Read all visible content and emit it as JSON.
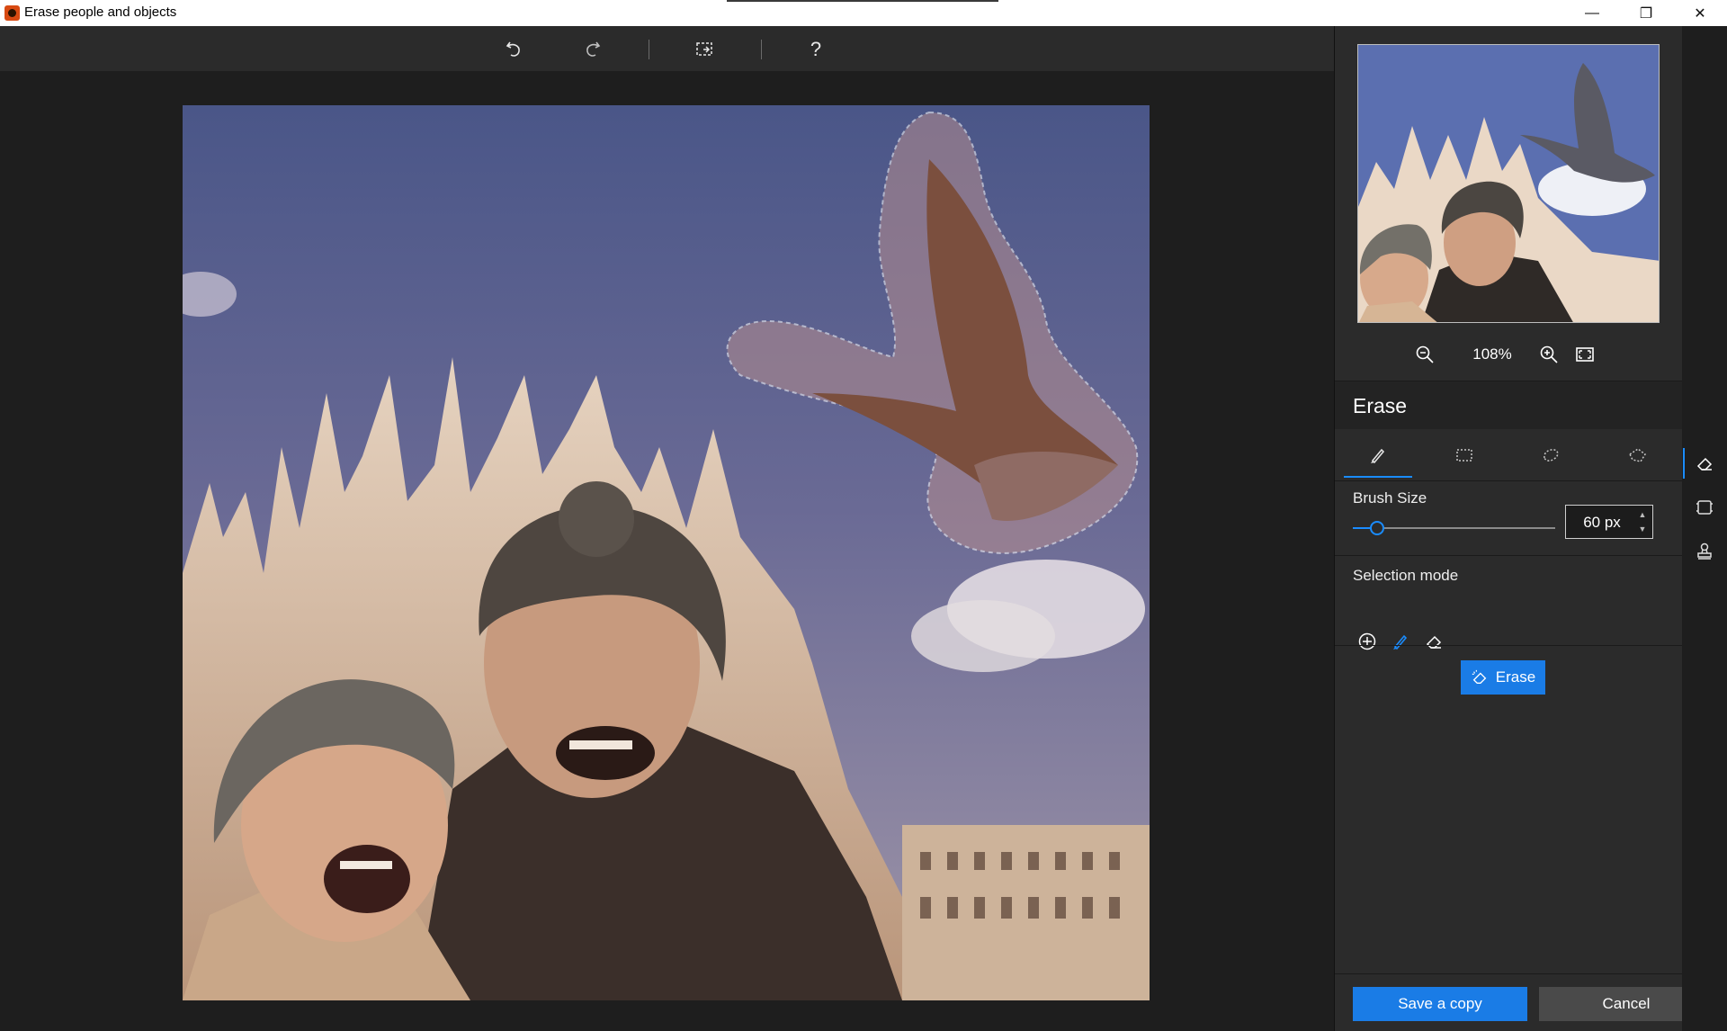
{
  "window": {
    "title": "Erase people and objects",
    "minimize_glyph": "—",
    "maximize_glyph": "❐",
    "close_glyph": "✕"
  },
  "toolbar": {
    "undo_icon": "undo-icon",
    "redo_icon": "redo-icon",
    "compare_icon": "compare-icon",
    "help_label": "?"
  },
  "preview": {
    "zoom_level": "108%",
    "zoom_out_icon": "zoom-out-icon",
    "zoom_in_icon": "zoom-in-icon",
    "fit_icon": "fit-to-screen-icon"
  },
  "panel": {
    "section_title": "Erase",
    "tools": [
      {
        "icon": "brush-icon",
        "active": true
      },
      {
        "icon": "rectangle-select-icon",
        "active": false
      },
      {
        "icon": "lasso-icon",
        "active": false
      },
      {
        "icon": "polygon-lasso-icon",
        "active": false
      }
    ],
    "brush_size_label": "Brush Size",
    "brush_size_value": "60 px",
    "brush_size_fraction": 0.12,
    "selection_mode_label": "Selection mode",
    "selection_modes": [
      "add-icon",
      "brush-icon",
      "eraser-icon"
    ],
    "erase_button_label": "Erase"
  },
  "footer": {
    "save_label": "Save a copy",
    "cancel_label": "Cancel"
  },
  "rail": {
    "items": [
      "eraser-icon",
      "crop-icon",
      "stamp-icon"
    ],
    "active_index": 0
  },
  "colors": {
    "accent": "#1a7ce6",
    "panel_bg": "#2b2b2b",
    "canvas_bg": "#1e1e1e"
  }
}
